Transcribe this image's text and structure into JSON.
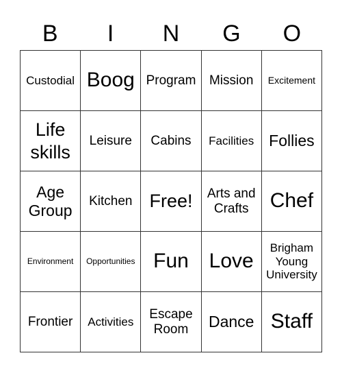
{
  "header": {
    "letters": [
      "B",
      "I",
      "N",
      "G",
      "O"
    ]
  },
  "board": {
    "rows": [
      [
        "Custodial",
        "Boog",
        "Program",
        "Mission",
        "Excitement"
      ],
      [
        "Life skills",
        "Leisure",
        "Cabins",
        "Facilities",
        "Follies"
      ],
      [
        "Age Group",
        "Kitchen",
        "Free!",
        "Arts and Crafts",
        "Chef"
      ],
      [
        "Environment",
        "Opportunities",
        "Fun",
        "Love",
        "Brigham Young University"
      ],
      [
        "Frontier",
        "Activities",
        "Escape Room",
        "Dance",
        "Staff"
      ]
    ]
  }
}
